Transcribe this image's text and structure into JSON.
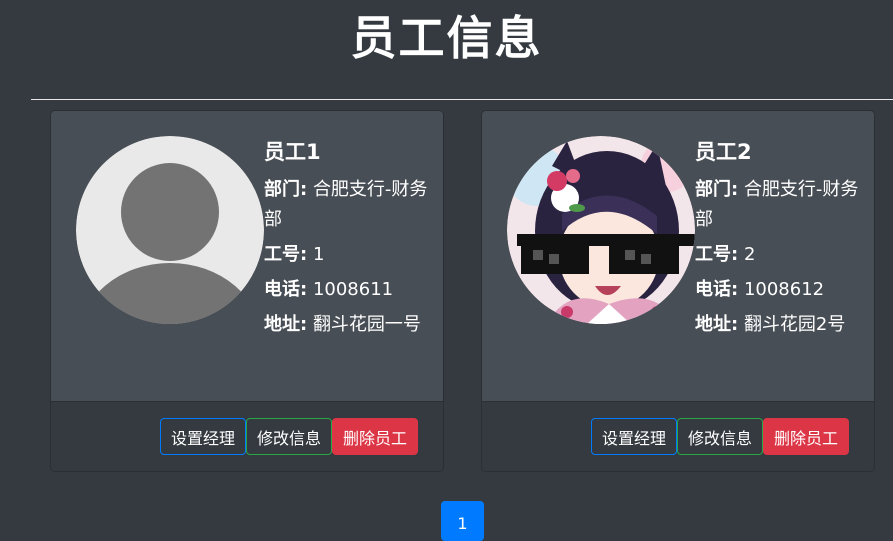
{
  "page": {
    "title": "员工信息"
  },
  "employees": [
    {
      "name": "员工1",
      "dept_label": "部门:",
      "dept": "合肥支行-财务部",
      "id_label": "工号:",
      "id": "1",
      "phone_label": "电话:",
      "phone": "1008611",
      "addr_label": "地址:",
      "addr": "翻斗花园一号",
      "avatar": "default-user-icon"
    },
    {
      "name": "员工2",
      "dept_label": "部门:",
      "dept": "合肥支行-财务部",
      "id_label": "工号:",
      "id": "2",
      "phone_label": "电话:",
      "phone": "1008612",
      "addr_label": "地址:",
      "addr": "翻斗花园2号",
      "avatar": "anime-avatar"
    }
  ],
  "actions": {
    "set_manager": "设置经理",
    "edit": "修改信息",
    "delete": "删除员工"
  },
  "pagination": {
    "current": "1"
  },
  "colors": {
    "background": "#343a40",
    "card": "#484e55",
    "primary": "#007bff",
    "success": "#28a745",
    "danger": "#dc3545"
  }
}
